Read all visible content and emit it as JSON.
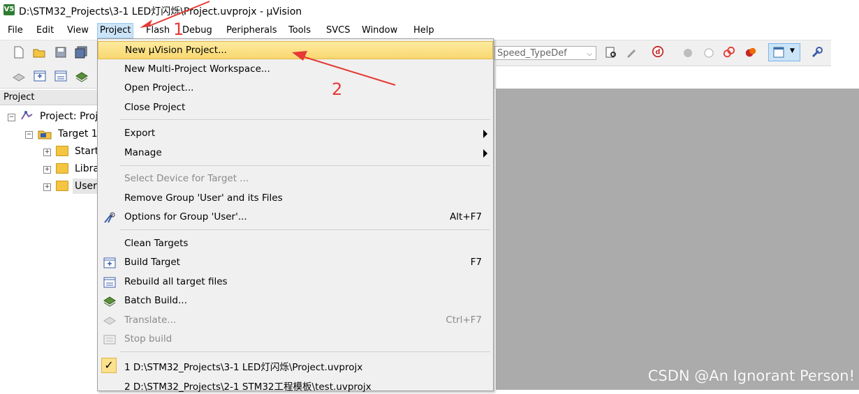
{
  "window": {
    "title": "D:\\STM32_Projects\\3-1 LED灯闪烁\\Project.uvprojx - µVision",
    "icon_label": "V5"
  },
  "menubar": {
    "items": [
      "File",
      "Edit",
      "View",
      "Project",
      "Flash",
      "Debug",
      "Peripherals",
      "Tools",
      "SVCS",
      "Window",
      "Help"
    ],
    "active": "Project"
  },
  "toolbar": {
    "combo_value": "Speed_TypeDef"
  },
  "project_pane": {
    "header": "Project",
    "root": "Project: Proj",
    "target": "Target 1",
    "groups": [
      "Start",
      "Libra",
      "User"
    ]
  },
  "project_menu": {
    "items": [
      {
        "label": "New µVision Project...",
        "highlighted": true
      },
      {
        "label": "New Multi-Project Workspace..."
      },
      {
        "label": "Open Project..."
      },
      {
        "label": "Close Project"
      },
      {
        "label": "Export",
        "submenu": true
      },
      {
        "label": "Manage",
        "submenu": true
      },
      {
        "label": "Select Device for Target ...",
        "disabled": true
      },
      {
        "label": "Remove Group 'User' and its Files"
      },
      {
        "label": "Options for Group 'User'...",
        "shortcut": "Alt+F7",
        "icon": "options-icon"
      },
      {
        "label": "Clean Targets"
      },
      {
        "label": "Build Target",
        "shortcut": "F7",
        "icon": "build-icon"
      },
      {
        "label": "Rebuild all target files",
        "icon": "rebuild-icon"
      },
      {
        "label": "Batch Build...",
        "icon": "batch-build-icon"
      },
      {
        "label": "Translate...",
        "shortcut": "Ctrl+F7",
        "disabled": true,
        "icon": "translate-icon"
      },
      {
        "label": "Stop build",
        "disabled": true,
        "icon": "stop-build-icon"
      },
      {
        "label": "1 D:\\STM32_Projects\\3-1 LED灯闪烁\\Project.uvprojx",
        "checked": true
      },
      {
        "label": "2 D:\\STM32_Projects\\2-1 STM32工程模板\\test.uvprojx"
      }
    ]
  },
  "annotations": [
    "1",
    "2"
  ],
  "watermark": "CSDN @An Ignorant Person!",
  "colors": {
    "highlight": "#f9d770",
    "arrow": "#e53935",
    "editor_bg": "#ababab"
  }
}
